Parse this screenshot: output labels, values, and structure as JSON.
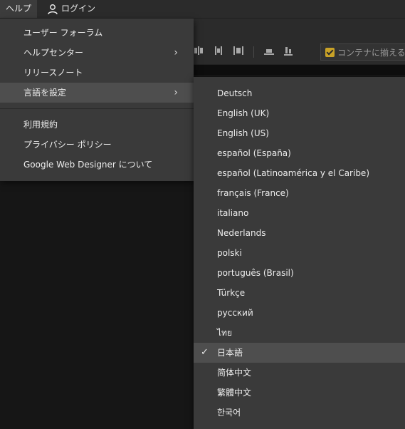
{
  "menubar": {
    "help_label": "ヘルプ",
    "login_label": "ログイン"
  },
  "toolbar": {
    "container_fit_label": "コンテナに揃える"
  },
  "help_menu": {
    "items": [
      {
        "label": "ユーザー フォーラム",
        "has_submenu": false
      },
      {
        "label": "ヘルプセンター",
        "has_submenu": true
      },
      {
        "label": "リリースノート",
        "has_submenu": false
      },
      {
        "label": "言語を設定",
        "has_submenu": true
      },
      {
        "label": "利用規約",
        "has_submenu": false
      },
      {
        "label": "プライバシー ポリシー",
        "has_submenu": false
      },
      {
        "label": "Google Web Designer について",
        "has_submenu": false
      }
    ],
    "submenu_arrow": "›"
  },
  "language_menu": {
    "selected": "日本語",
    "check_mark": "✓",
    "items": [
      "Deutsch",
      "English (UK)",
      "English (US)",
      "español (España)",
      "español (Latinoamérica y el Caribe)",
      "français (France)",
      "italiano",
      "Nederlands",
      "polski",
      "português (Brasil)",
      "Türkçe",
      "русский",
      "ไทย",
      "日本語",
      "简体中文",
      "繁體中文",
      "한국어"
    ]
  }
}
